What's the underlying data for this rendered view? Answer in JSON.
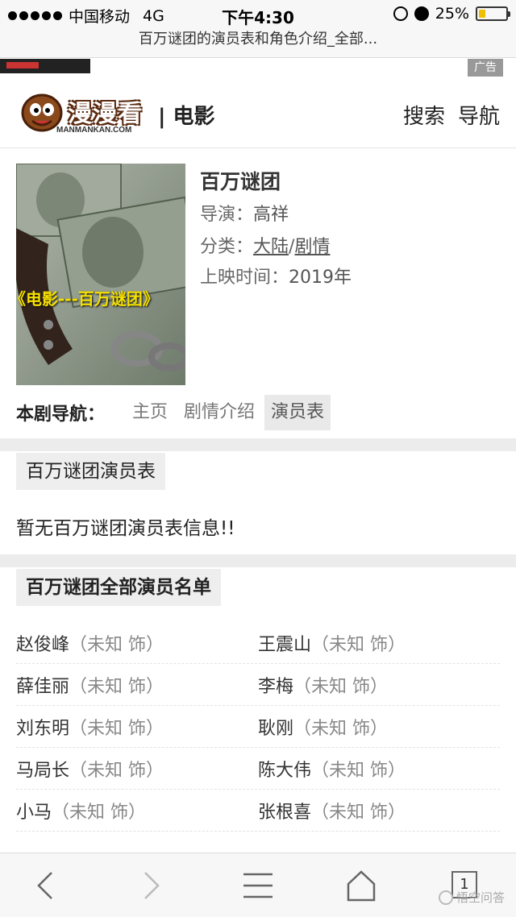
{
  "status_bar": {
    "carrier": "中国移动",
    "network": "4G",
    "time": "下午4:30",
    "battery_percent": "25%",
    "battery_level": 0.25
  },
  "browser": {
    "page_title": "百万谜团的演员表和角色介绍_全部..."
  },
  "ad": {
    "tag": "广告"
  },
  "site": {
    "logo_text": "漫漫看",
    "logo_sub": "MANMANKAN.COM",
    "section": "| 电影",
    "nav_search": "搜索",
    "nav_menu": "导航"
  },
  "movie": {
    "title": "百万谜团",
    "poster_caption": "《电影---百万谜团》",
    "director_label": "导演：",
    "director": "高祥",
    "category_label": "分类：",
    "category_1": "大陆",
    "category_sep": "/",
    "category_2": "剧情",
    "release_label": "上映时间：",
    "release": "2019年"
  },
  "drama_nav": {
    "label": "本剧导航：",
    "items": [
      "主页",
      "剧情介绍",
      "演员表"
    ],
    "active": "演员表"
  },
  "cast_table": {
    "title": "百万谜团演员表",
    "empty_message": "暂无百万谜团演员表信息!!"
  },
  "all_cast": {
    "title": "百万谜团全部演员名单",
    "rows": [
      {
        "left_name": "赵俊峰",
        "left_role": "（未知 饰）",
        "right_name": "王震山",
        "right_role": "（未知 饰）"
      },
      {
        "left_name": "薛佳丽",
        "left_role": "（未知 饰）",
        "right_name": "李梅",
        "right_role": "（未知 饰）"
      },
      {
        "left_name": "刘东明",
        "left_role": "（未知 饰）",
        "right_name": "耿刚",
        "right_role": "（未知 饰）"
      },
      {
        "left_name": "马局长",
        "left_role": "（未知 饰）",
        "right_name": "陈大伟",
        "right_role": "（未知 饰）"
      },
      {
        "left_name": "小马",
        "left_role": "（未知 饰）",
        "right_name": "张根喜",
        "right_role": "（未知 饰）"
      }
    ]
  },
  "toolbar": {
    "back_icon": "chevron-left-icon",
    "forward_icon": "chevron-right-icon",
    "menu_icon": "hamburger-icon",
    "home_icon": "home-icon",
    "tab_count": "1",
    "watermark": "悟空问答"
  },
  "colors": {
    "battery_fill": "#f0c000",
    "logo_outline": "#5a2a10",
    "poster_caption": "#f5e000",
    "active_nav_bg": "#e9e9e9"
  }
}
